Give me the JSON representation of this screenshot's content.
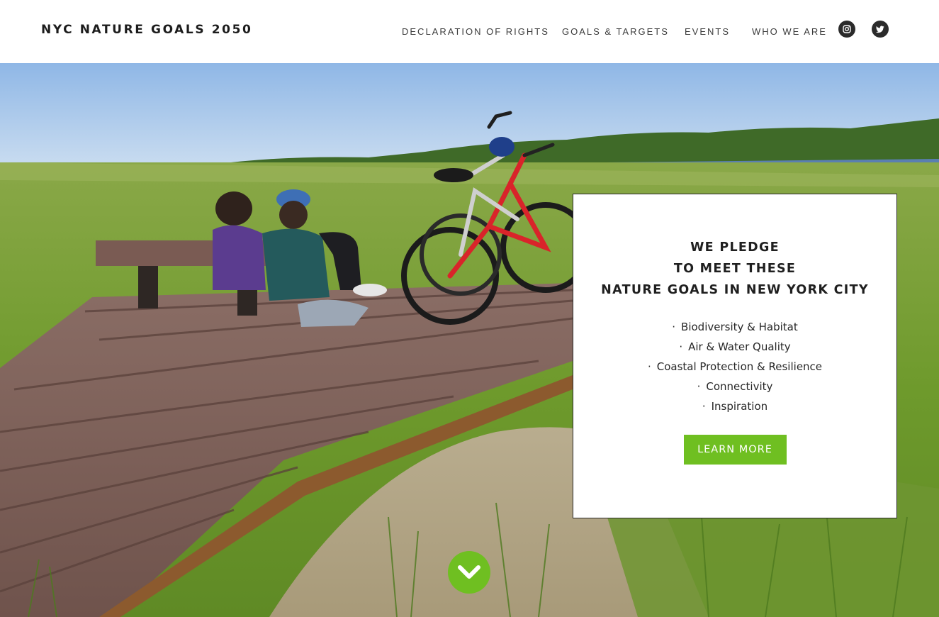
{
  "brand": {
    "title": "NYC NATURE GOALS 2050"
  },
  "nav": {
    "items": [
      {
        "label": "DECLARATION OF RIGHTS"
      },
      {
        "label": "GOALS & TARGETS"
      },
      {
        "label": "EVENTS"
      },
      {
        "label": "WHO WE ARE"
      }
    ],
    "social": [
      {
        "icon": "instagram-icon"
      },
      {
        "icon": "twitter-icon"
      }
    ]
  },
  "hero": {
    "image_description_icon": "photo-boardwalk-bikes"
  },
  "pledge": {
    "line1": "WE PLEDGE",
    "line2": "TO MEET THESE",
    "line3": "NATURE GOALS IN NEW YORK CITY",
    "goals": [
      "Biodiversity & Habitat",
      "Air & Water Quality",
      "Coastal Protection & Resilience",
      "Connectivity",
      "Inspiration"
    ],
    "bullet": "·",
    "button_label": "LEARN MORE"
  },
  "scroll": {
    "icon": "chevron-down-icon"
  },
  "colors": {
    "accent": "#6fbf21",
    "text": "#1f1f1f",
    "social_bg": "#2b2b2b"
  }
}
